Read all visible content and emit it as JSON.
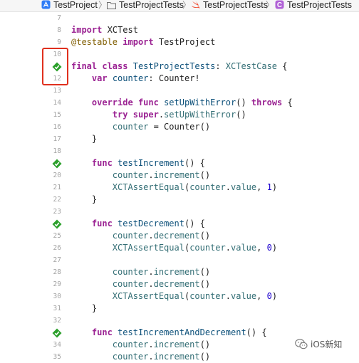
{
  "breadcrumbs": [
    {
      "label": "TestProject",
      "icon": "app-project-icon"
    },
    {
      "label": "TestProjectTests",
      "icon": "folder-icon"
    },
    {
      "label": "TestProjectTests",
      "icon": "swift-file-icon"
    },
    {
      "label": "TestProjectTests",
      "icon": "class-c-icon"
    }
  ],
  "lines": [
    {
      "num": "7"
    },
    {
      "num": "8"
    },
    {
      "num": "9"
    },
    {
      "num": "10"
    },
    {
      "num": "11",
      "test_passed": true
    },
    {
      "num": "12"
    },
    {
      "num": "13"
    },
    {
      "num": "14"
    },
    {
      "num": "15"
    },
    {
      "num": "16"
    },
    {
      "num": "17"
    },
    {
      "num": "18"
    },
    {
      "num": "19",
      "test_passed": true
    },
    {
      "num": "20"
    },
    {
      "num": "21"
    },
    {
      "num": "22"
    },
    {
      "num": "23"
    },
    {
      "num": "24",
      "test_passed": true
    },
    {
      "num": "25"
    },
    {
      "num": "26"
    },
    {
      "num": "27"
    },
    {
      "num": "28"
    },
    {
      "num": "29"
    },
    {
      "num": "30"
    },
    {
      "num": "31"
    },
    {
      "num": "32"
    },
    {
      "num": "33",
      "test_passed": true
    },
    {
      "num": "34"
    },
    {
      "num": "35"
    }
  ],
  "code": {
    "l8_a": "import",
    "l8_b": " XCTest",
    "l9_a": "@testable",
    "l9_b": " ",
    "l9_c": "import",
    "l9_d": " TestProject",
    "l11_a": "final",
    "l11_b": " ",
    "l11_c": "class",
    "l11_d": " ",
    "l11_e": "TestProjectTests",
    "l11_f": ": ",
    "l11_g": "XCTestCase",
    "l11_h": " {",
    "l12_a": "    ",
    "l12_b": "var",
    "l12_c": " ",
    "l12_d": "counter",
    "l12_e": ": Counter!",
    "l14_a": "    ",
    "l14_b": "override",
    "l14_c": " ",
    "l14_d": "func",
    "l14_e": " ",
    "l14_f": "setUpWithError",
    "l14_g": "() ",
    "l14_h": "throws",
    "l14_i": " {",
    "l15_a": "        ",
    "l15_b": "try",
    "l15_c": " ",
    "l15_d": "super",
    "l15_e": ".",
    "l15_f": "setUpWithError",
    "l15_g": "()",
    "l16_a": "        ",
    "l16_b": "counter",
    "l16_c": " = Counter()",
    "l17": "    }",
    "l19_a": "    ",
    "l19_b": "func",
    "l19_c": " ",
    "l19_d": "testIncrement",
    "l19_e": "() {",
    "l20_a": "        ",
    "l20_b": "counter",
    "l20_c": ".",
    "l20_d": "increment",
    "l20_e": "()",
    "l21_a": "        ",
    "l21_b": "XCTAssertEqual",
    "l21_c": "(",
    "l21_d": "counter",
    "l21_e": ".",
    "l21_f": "value",
    "l21_g": ", ",
    "l21_h": "1",
    "l21_i": ")",
    "l22": "    }",
    "l24_a": "    ",
    "l24_b": "func",
    "l24_c": " ",
    "l24_d": "testDecrement",
    "l24_e": "() {",
    "l25_a": "        ",
    "l25_b": "counter",
    "l25_c": ".",
    "l25_d": "decrement",
    "l25_e": "()",
    "l26_a": "        ",
    "l26_b": "XCTAssertEqual",
    "l26_c": "(",
    "l26_d": "counter",
    "l26_e": ".",
    "l26_f": "value",
    "l26_g": ", ",
    "l26_h": "0",
    "l26_i": ")",
    "l28_a": "        ",
    "l28_b": "counter",
    "l28_c": ".",
    "l28_d": "increment",
    "l28_e": "()",
    "l29_a": "        ",
    "l29_b": "counter",
    "l29_c": ".",
    "l29_d": "decrement",
    "l29_e": "()",
    "l30_a": "        ",
    "l30_b": "XCTAssertEqual",
    "l30_c": "(",
    "l30_d": "counter",
    "l30_e": ".",
    "l30_f": "value",
    "l30_g": ", ",
    "l30_h": "0",
    "l30_i": ")",
    "l31": "    }",
    "l33_a": "    ",
    "l33_b": "func",
    "l33_c": " ",
    "l33_d": "testIncrementAndDecrement",
    "l33_e": "() {",
    "l34_a": "        ",
    "l34_b": "counter",
    "l34_c": ".",
    "l34_d": "increment",
    "l34_e": "()",
    "l35_a": "        ",
    "l35_b": "counter",
    "l35_c": ".",
    "l35_d": "increment",
    "l35_e": "()"
  },
  "watermark": {
    "text": "iOS新知",
    "icon": "wechat-icon"
  },
  "colors": {
    "keyword": "#9b2393",
    "type": "#0b4f79",
    "identifier": "#326d74",
    "number": "#1c00cf",
    "attribute": "#815f03",
    "test_pass": "#2ca02c",
    "highlight_box": "#e0301e"
  }
}
